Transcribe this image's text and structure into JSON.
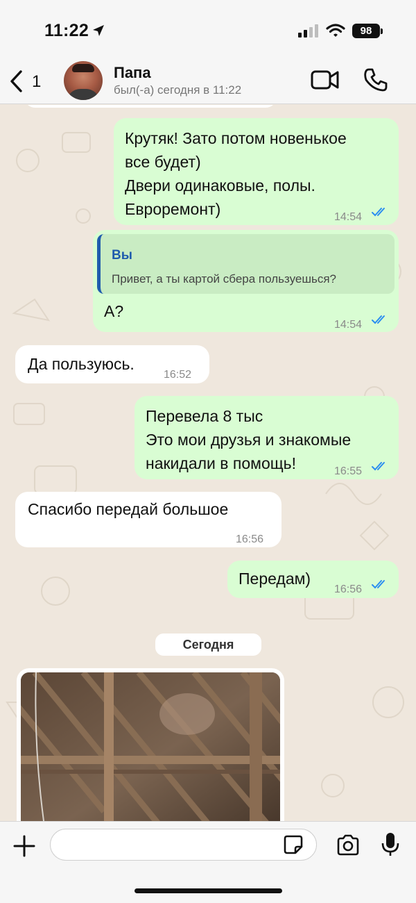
{
  "status_bar": {
    "time": "11:22",
    "battery": "98"
  },
  "header": {
    "back_count": "1",
    "contact_name": "Папа",
    "contact_status": "был(-а) сегодня в 11:22"
  },
  "messages": [
    {
      "direction": "out",
      "lines": [
        "Крутяк! Зато потом новенькое",
        "все будет)",
        "Двери одинаковые, полы.",
        "Евроремонт)"
      ],
      "time": "14:54",
      "read": true
    },
    {
      "direction": "out",
      "quote_name": "Вы",
      "quote_text": "Привет, а ты картой сбера пользуешься?",
      "text": "А?",
      "time": "14:54",
      "read": true
    },
    {
      "direction": "in",
      "text": "Да пользуюсь.",
      "time": "16:52"
    },
    {
      "direction": "out",
      "lines": [
        "Перевела 8 тыс",
        "Это мои друзья и знакомые",
        "накидали в помощь!"
      ],
      "time": "16:55",
      "read": true
    },
    {
      "direction": "in",
      "text": "Спасибо передай большое",
      "time": "16:56"
    },
    {
      "direction": "out",
      "text": "Передам)",
      "time": "16:56",
      "read": true
    }
  ],
  "date_separator": "Сегодня",
  "input": {
    "placeholder": ""
  },
  "colors": {
    "outgoing_bubble": "#d9fdd3",
    "incoming_bubble": "#ffffff",
    "tick_blue": "#2b8ef0",
    "quote_accent": "#1f5cad",
    "background": "#efe7dd"
  },
  "icons": [
    "location-arrow-icon",
    "signal-icon",
    "wifi-icon",
    "back-chevron-icon",
    "video-call-icon",
    "phone-icon",
    "plus-icon",
    "sticker-icon",
    "camera-icon",
    "microphone-icon",
    "double-check-icon"
  ]
}
